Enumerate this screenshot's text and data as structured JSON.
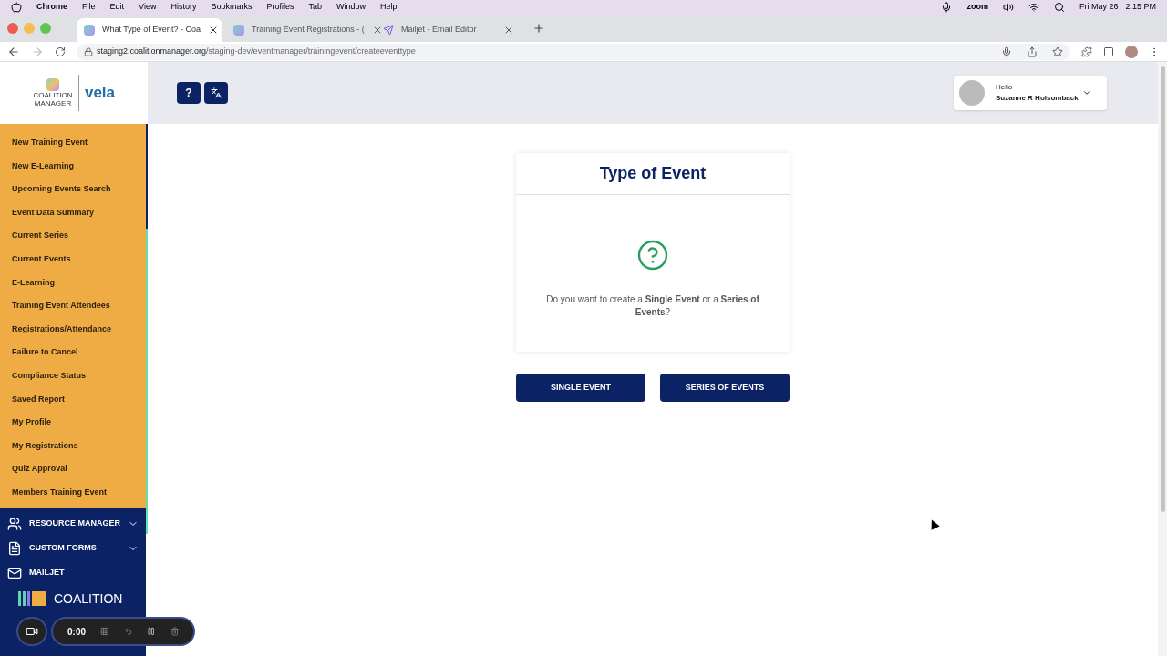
{
  "menubar": {
    "app": "Chrome",
    "items": [
      "File",
      "Edit",
      "View",
      "History",
      "Bookmarks",
      "Profiles",
      "Tab",
      "Window",
      "Help"
    ],
    "zoom_label": "zoom",
    "date": "Fri May 26",
    "time": "2:15 PM"
  },
  "browser_tabs": [
    {
      "title": "What Type of Event? - Coa",
      "selected": true,
      "kind": "app"
    },
    {
      "title": "Training Event Registrations - (",
      "selected": false,
      "kind": "app"
    },
    {
      "title": "Mailjet - Email Editor",
      "selected": false,
      "kind": "send"
    }
  ],
  "address": {
    "host": "staging2.coalitionmanager.org",
    "path": "/staging-dev/eventmanager/trainingevent/createeventtype"
  },
  "logo": {
    "left": "COALITION MANAGER",
    "right": "vela"
  },
  "header": {
    "help_label": "?",
    "greeting": "Hello",
    "user": "Suzanne R Holsomback"
  },
  "sidebar": {
    "items": [
      {
        "label": "New Training Event"
      },
      {
        "label": "New E-Learning"
      },
      {
        "label": "Upcoming Events Search"
      },
      {
        "label": "Event Data Summary"
      },
      {
        "label": "Current Series"
      },
      {
        "label": "Current Events"
      },
      {
        "label": "E-Learning"
      },
      {
        "label": "Training Event Attendees"
      },
      {
        "label": "Registrations/Attendance"
      },
      {
        "label": "Failure to Cancel"
      },
      {
        "label": "Compliance Status"
      },
      {
        "label": "Saved Report"
      },
      {
        "label": "My Profile"
      },
      {
        "label": "My Registrations"
      },
      {
        "label": "Quiz Approval"
      },
      {
        "label": "Members Training Event"
      }
    ],
    "sections": [
      {
        "label": "RESOURCE MANAGER",
        "kind": "people",
        "expandable": true
      },
      {
        "label": "CUSTOM FORMS",
        "kind": "form",
        "expandable": true
      },
      {
        "label": "MAILJET",
        "kind": "mail",
        "expandable": false
      }
    ],
    "footer_logo": "COALITION"
  },
  "card": {
    "title": "Type of Event",
    "question": "Do you want to create a **Single Event** or a **Series of Events**?"
  },
  "buttons": [
    "SINGLE EVENT",
    "SERIES OF EVENTS"
  ],
  "recorder": {
    "time": "0:00"
  }
}
